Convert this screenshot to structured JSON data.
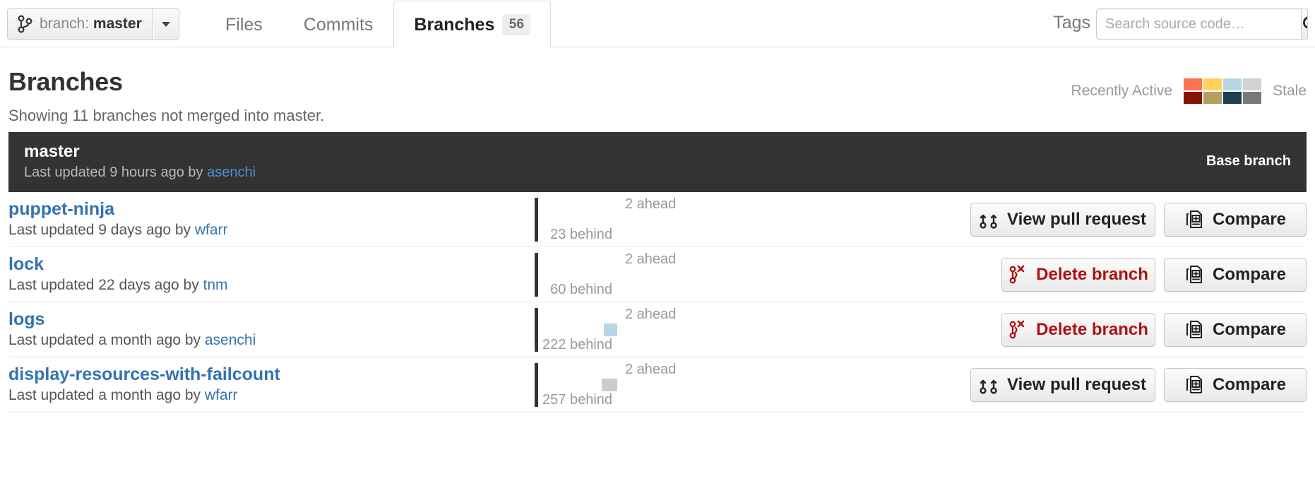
{
  "header": {
    "branch_selector": {
      "icon": "git-branch-icon",
      "prefix": "branch:",
      "value": "master",
      "caret_icon": "chevron-down-icon"
    },
    "tabs": [
      {
        "label": "Files",
        "active": false
      },
      {
        "label": "Commits",
        "active": false
      },
      {
        "label": "Branches",
        "active": true,
        "count": "56"
      }
    ],
    "tags_label": "Tags",
    "search": {
      "placeholder": "Search source code…",
      "value": "",
      "icon": "search-icon"
    }
  },
  "page": {
    "title": "Branches",
    "subtitle": "Showing 11 branches not merged into master."
  },
  "legend": {
    "left_label": "Recently Active",
    "right_label": "Stale",
    "swatches_top": [
      "#fd7253",
      "#ffd25f",
      "#b6d6e5",
      "#d2d2d2"
    ],
    "swatches_bottom": [
      "#861203",
      "#b59e64",
      "#1e3e50",
      "#787878"
    ]
  },
  "master_row": {
    "name": "master",
    "meta_prefix": "Last updated 9 hours ago by ",
    "author": "asenchi",
    "badge": "Base branch"
  },
  "branches": [
    {
      "name": "puppet-ninja",
      "meta_prefix": "Last updated 9 days ago by ",
      "author": "wfarr",
      "ahead": "2 ahead",
      "behind": "23 behind",
      "behind_bar_width": 0,
      "behind_bar_color": "#ffffff",
      "primary_action": "View pull request",
      "primary_icon": "pull-request-icon",
      "primary_kind": "pr",
      "compare_action": "Compare",
      "compare_icon": "compare-icon"
    },
    {
      "name": "lock",
      "meta_prefix": "Last updated 22 days ago by ",
      "author": "tnm",
      "ahead": "2 ahead",
      "behind": "60 behind",
      "behind_bar_width": 0,
      "behind_bar_color": "#ffffff",
      "primary_action": "Delete branch",
      "primary_icon": "delete-branch-icon",
      "primary_kind": "delete",
      "compare_action": "Compare",
      "compare_icon": "compare-icon"
    },
    {
      "name": "logs",
      "meta_prefix": "Last updated a month ago by ",
      "author": "asenchi",
      "ahead": "2 ahead",
      "behind": "222 behind",
      "behind_bar_width": 19,
      "behind_bar_color": "#b6d6e5",
      "primary_action": "Delete branch",
      "primary_icon": "delete-branch-icon",
      "primary_kind": "delete",
      "compare_action": "Compare",
      "compare_icon": "compare-icon"
    },
    {
      "name": "display-resources-with-failcount",
      "meta_prefix": "Last updated a month ago by ",
      "author": "wfarr",
      "ahead": "2 ahead",
      "behind": "257 behind",
      "behind_bar_width": 22,
      "behind_bar_color": "#cccccc",
      "primary_action": "View pull request",
      "primary_icon": "pull-request-icon",
      "primary_kind": "pr",
      "compare_action": "Compare",
      "compare_icon": "compare-icon"
    }
  ]
}
